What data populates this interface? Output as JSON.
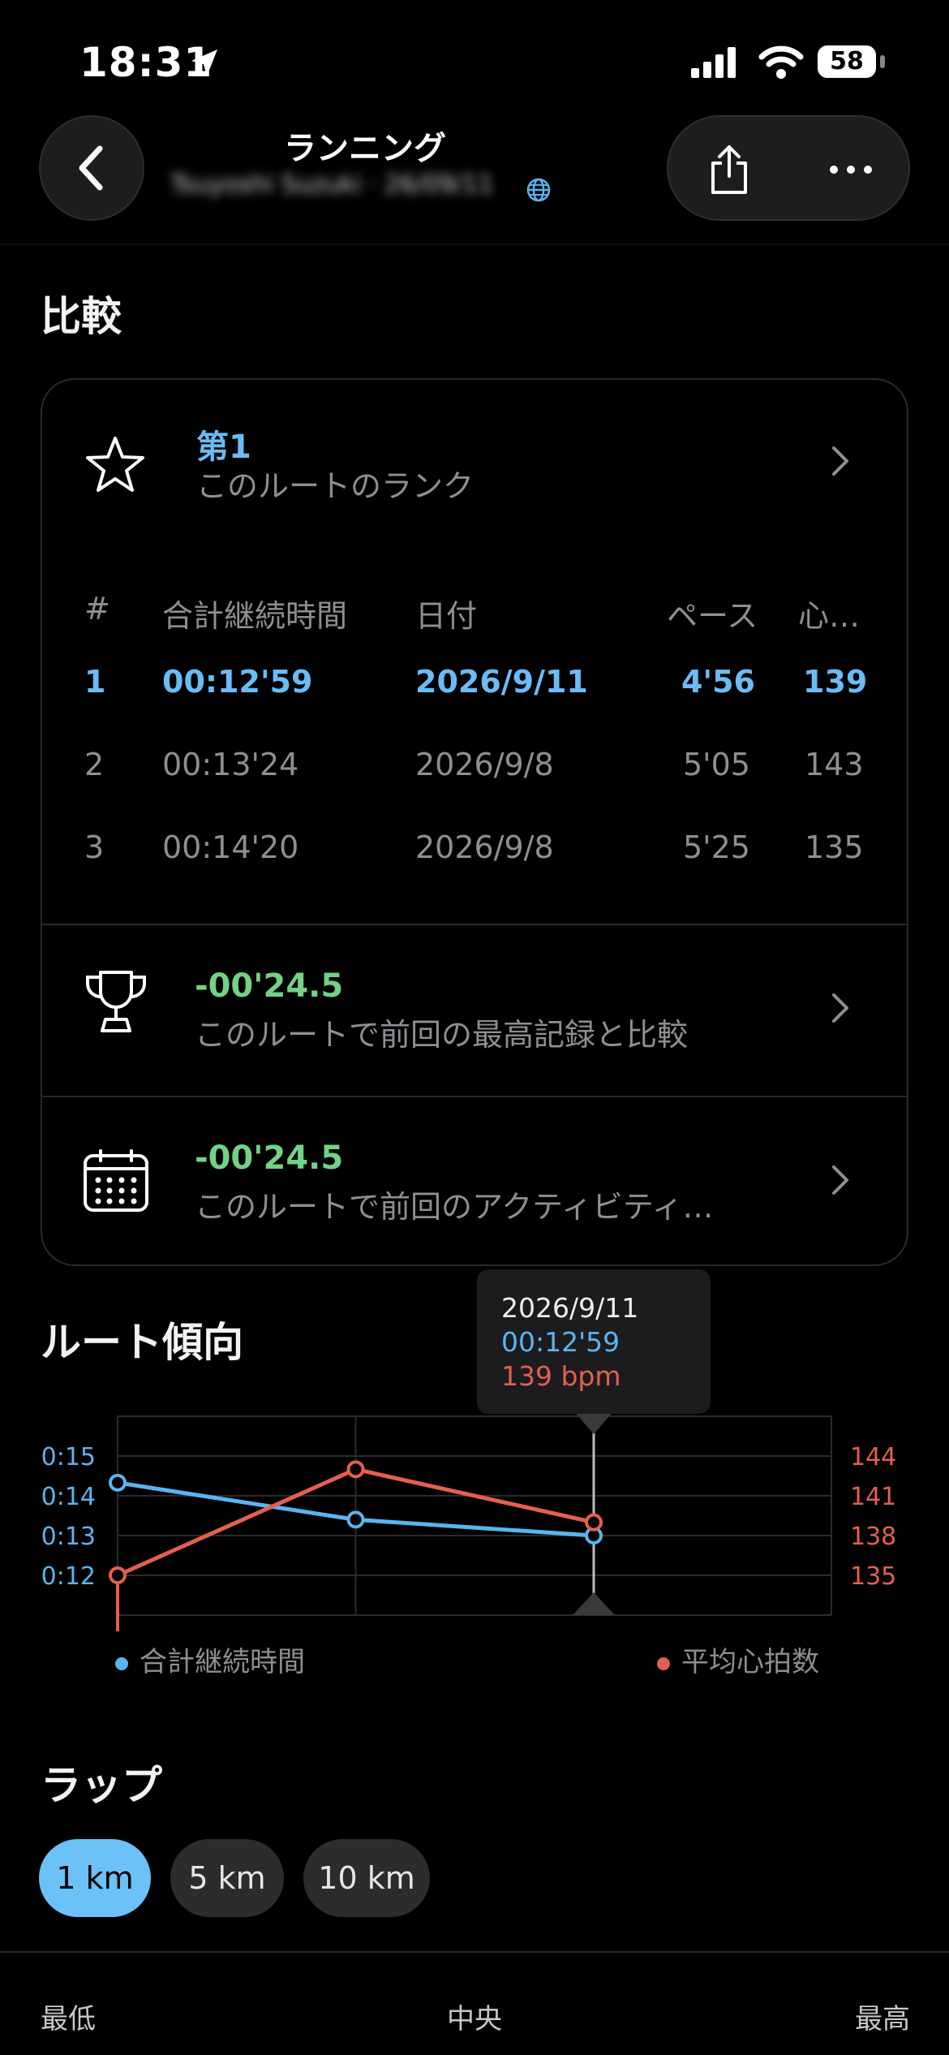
{
  "status_bar": {
    "time": "18:31",
    "battery": "58"
  },
  "header": {
    "title": "ランニング",
    "subtitle": "Tsuyoshi Suzuki · 26/09/11"
  },
  "compare": {
    "section_title": "比較",
    "rank": {
      "title": "第1",
      "subtitle": "このルートのランク"
    },
    "table": {
      "headers": [
        "#",
        "合計継続時間",
        "日付",
        "ペース",
        "心…"
      ],
      "rows": [
        {
          "rank": "1",
          "duration": "00:12'59",
          "date": "2026/9/11",
          "pace": "4'56",
          "hr": "139"
        },
        {
          "rank": "2",
          "duration": "00:13'24",
          "date": "2026/9/8",
          "pace": "5'05",
          "hr": "143"
        },
        {
          "rank": "3",
          "duration": "00:14'20",
          "date": "2026/9/8",
          "pace": "5'25",
          "hr": "135"
        }
      ]
    },
    "best": {
      "value": "-00'24.5",
      "subtitle": "このルートで前回の最高記録と比較"
    },
    "previous": {
      "value": "-00'24.5",
      "subtitle": "このルートで前回のアクティビティ…"
    }
  },
  "trend": {
    "section_title": "ルート傾向",
    "tooltip": {
      "date": "2026/9/11",
      "duration": "00:12'59",
      "hr": "139 bpm"
    },
    "legend": {
      "duration": "合計継続時間",
      "hr": "平均心拍数"
    },
    "colors": {
      "duration": "#5ab4ee",
      "hr": "#e2604f"
    },
    "chart_data": {
      "type": "line",
      "x": [
        1,
        2,
        3
      ],
      "y_left_ticks": [
        "0:15",
        "0:14",
        "0:13",
        "0:12"
      ],
      "y_left_range": [
        0.11,
        0.16
      ],
      "y_right_ticks": [
        "144",
        "141",
        "138",
        "135"
      ],
      "y_right_range": [
        132,
        147
      ],
      "series": [
        {
          "name": "合計継続時間",
          "axis": "left",
          "values": [
            0.1433,
            0.134,
            0.13
          ]
        },
        {
          "name": "平均心拍数",
          "axis": "right",
          "values": [
            135,
            143,
            139
          ]
        }
      ],
      "selected_index": 2
    }
  },
  "laps": {
    "section_title": "ラップ",
    "options": [
      "1 km",
      "5 km",
      "10 km"
    ],
    "selected": "1 km",
    "scale": {
      "min": "最低",
      "mid": "中央",
      "max": "最高"
    }
  }
}
